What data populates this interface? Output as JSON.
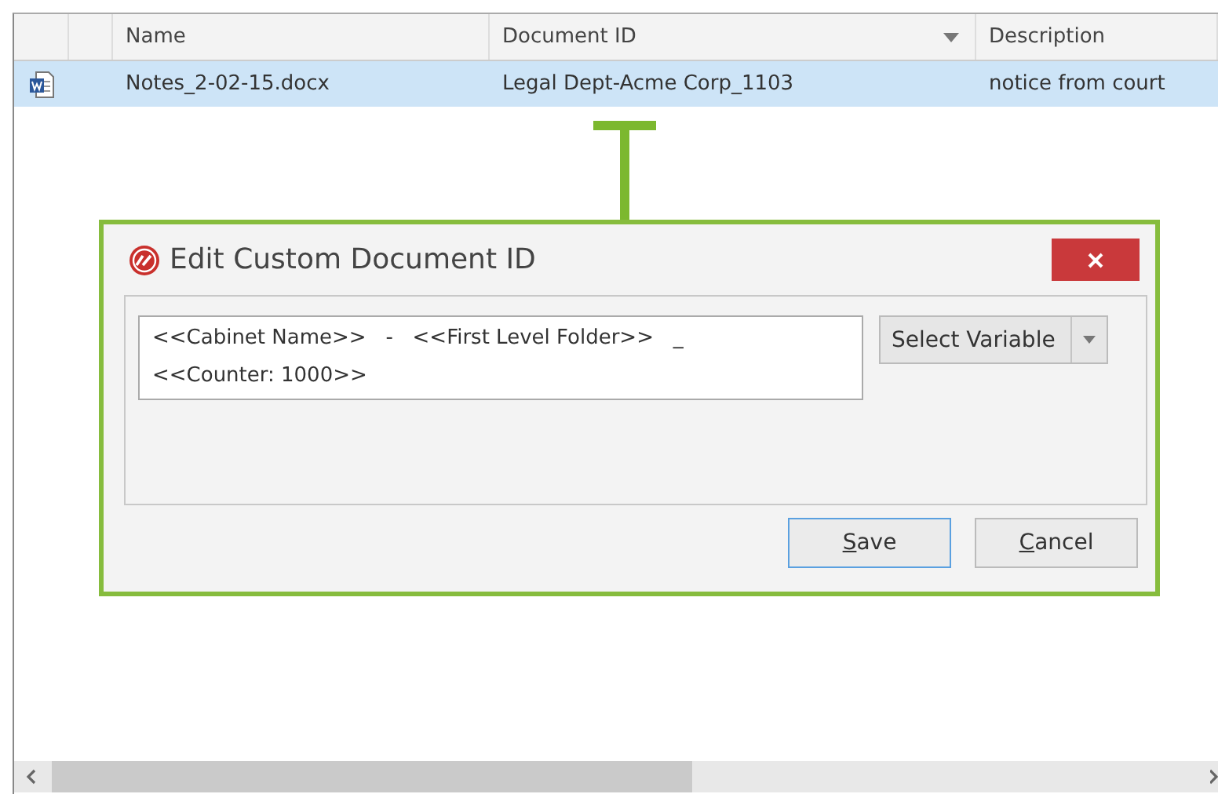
{
  "table": {
    "columns": [
      {
        "label": "Name",
        "sort_menu": false
      },
      {
        "label": "Document ID",
        "sort_menu": true
      },
      {
        "label": "Description",
        "sort_menu": false
      }
    ],
    "rows": [
      {
        "kind": "word",
        "selected": true,
        "cells": [
          "Notes_2-02-15.docx",
          "Legal Dept-Acme Corp_1103",
          "notice from court"
        ]
      }
    ]
  },
  "dialog": {
    "title": "Edit Custom Document ID",
    "field": {
      "value": "<<Cabinet Name>>   -   <<First Level Folder>>   _\n<<Counter: 1000>>"
    },
    "variable_button": "Select Variable",
    "buttons": [
      {
        "label": "Save",
        "default": true
      },
      {
        "label": "Cancel",
        "default": false
      }
    ]
  }
}
